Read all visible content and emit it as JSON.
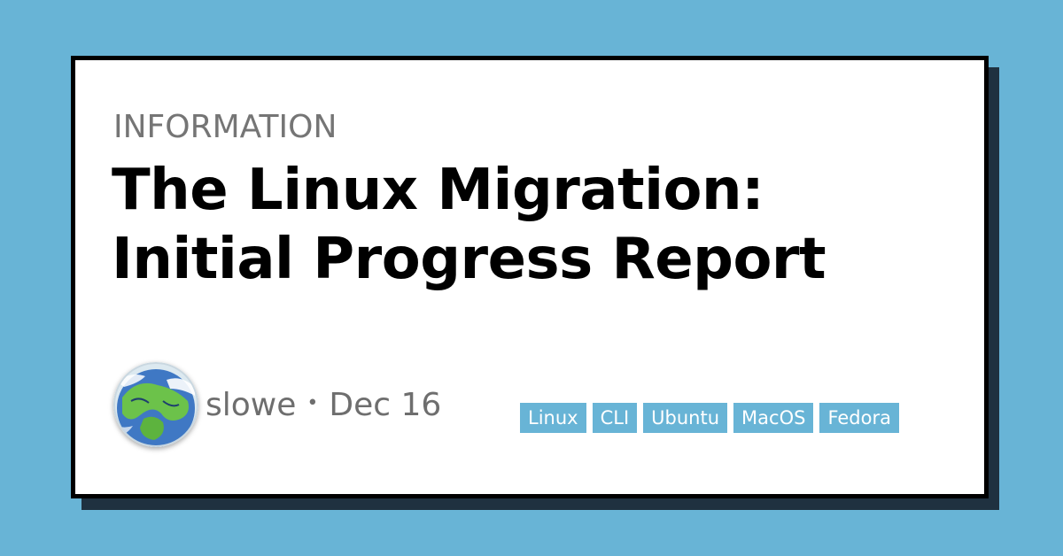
{
  "post": {
    "category": "INFORMATION",
    "title_lines": [
      "The Linux Migration:",
      "Initial Progress Report"
    ],
    "author": "slowe",
    "separator": "•",
    "date": "Dec 16",
    "avatar_icon": "globe-avatar-icon",
    "tags": [
      "Linux",
      "CLI",
      "Ubuntu",
      "MacOS",
      "Fedora"
    ]
  },
  "colors": {
    "background": "#68b4d6",
    "shadow": "#1f3140",
    "card": "#ffffff",
    "border": "#000000",
    "category_text": "#757575",
    "tag_bg": "#68b4d6",
    "tag_text": "#ffffff"
  }
}
